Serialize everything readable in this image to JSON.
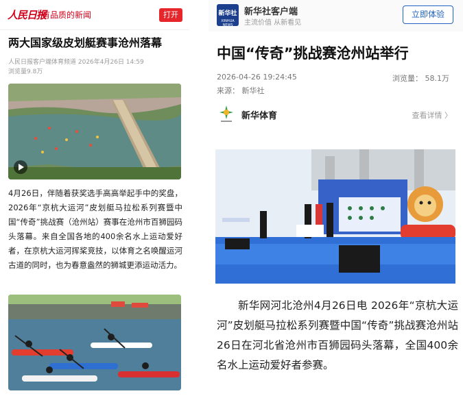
{
  "left": {
    "logo_text": "人民日报",
    "slogan": "有品质的新闻",
    "open_button": "打开",
    "title": "两大国家级皮划艇赛事沧州落幕",
    "meta_source": "人民日报客户端体育频道 2026年4月26日 14:59",
    "meta_views": "浏览量9.8万",
    "body": "4月26日，伴随着获奖选手高高举起手中的奖盘，2026年“京杭大运河”皮划艇马拉松系列赛暨中国“传奇”挑战赛（沧州站）赛事在沧州市百狮园码头落幕。来自全国各地的400余名水上运动爱好者，在京杭大运河挥桨竞技，以体育之名唤醒运河古道的同时，也为春意盎然的狮城更添运动活力。"
  },
  "right": {
    "logo_glyph": "新华社",
    "logo_sub": "XINHUA NEWS",
    "app_name": "新华社客户端",
    "tagline": "主流价值 从新看见",
    "try_button": "立即体验",
    "title": "中国“传奇”挑战赛沧州站举行",
    "datetime": "2026-04-26 19:24:45",
    "views": "浏览量： 58.1万",
    "source": "来源： 新华社",
    "channel": "新华体育",
    "detail_link": "查看详情 〉",
    "body": "新华网河北沧州4月26日电 2026年“京杭大运河”皮划艇马拉松系列赛暨中国“传奇”挑战赛沧州站26日在河北省沧州市百狮园码头落幕，全国400余名水上运动爱好者参赛。"
  },
  "colors": {
    "people_red": "#d0021b",
    "xinhua_blue": "#1f62c4"
  }
}
